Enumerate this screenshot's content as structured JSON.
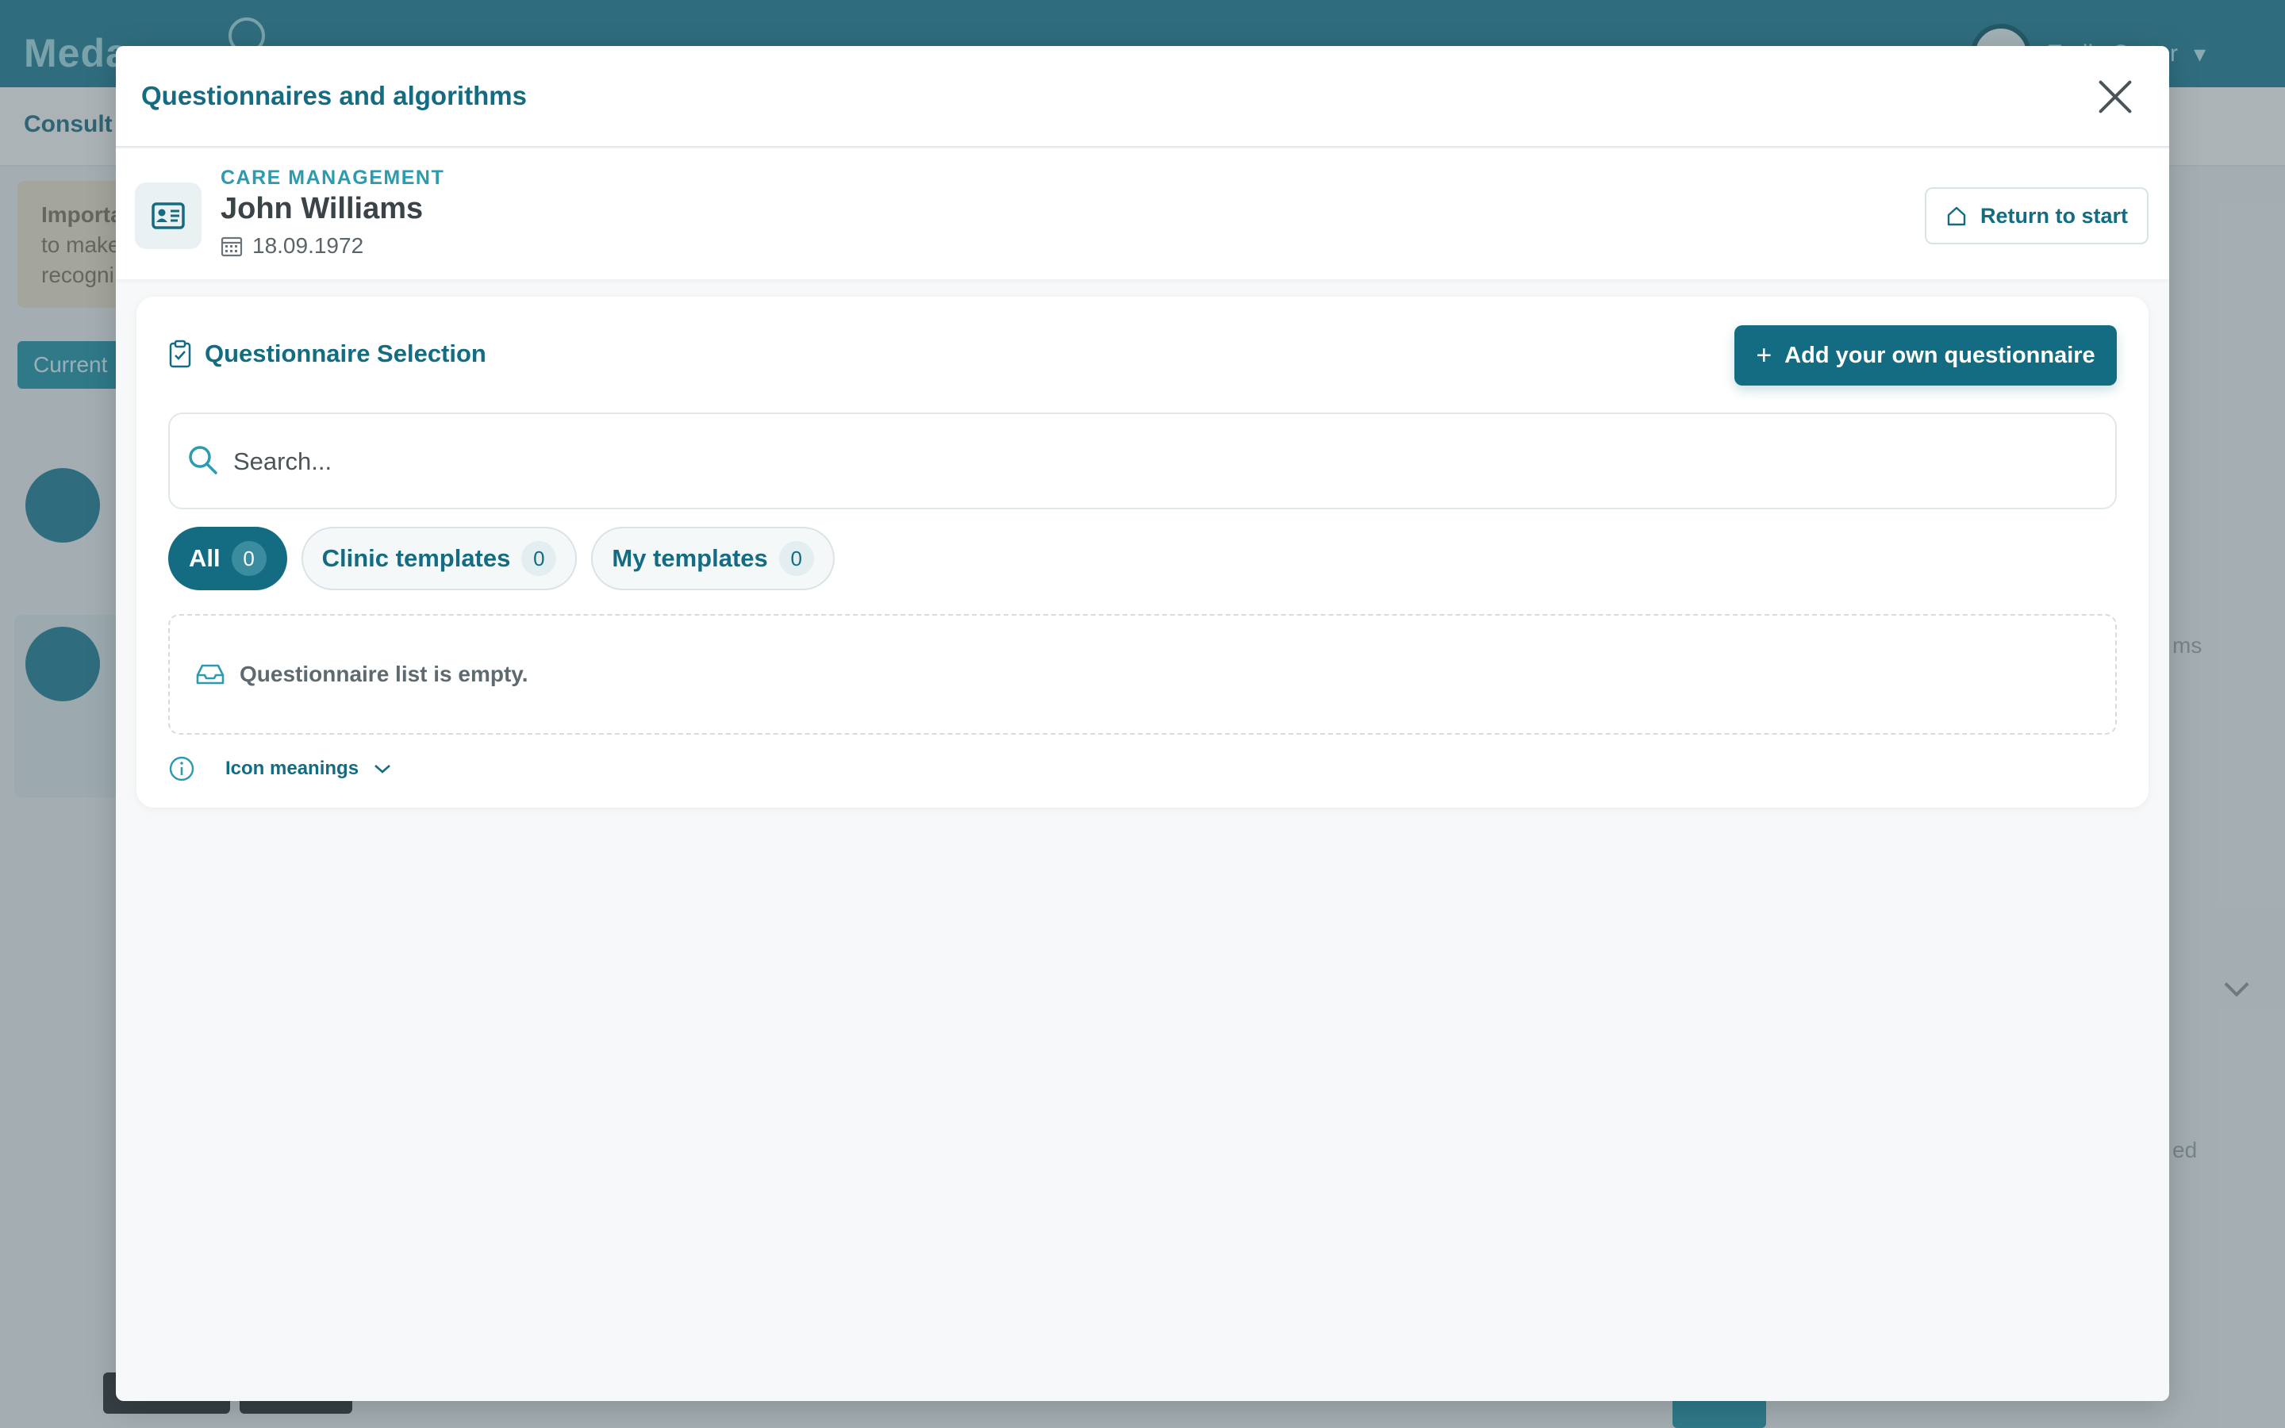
{
  "background": {
    "logo": "Meda",
    "user_name": "Emily Carter",
    "subtitle": "Consult",
    "alert_lines": [
      "Importa",
      "to make",
      "recogni"
    ],
    "current_label": "Current",
    "right_labels": [
      "ms",
      "ed"
    ]
  },
  "modal": {
    "title": "Questionnaires and algorithms",
    "close_icon": "close-icon"
  },
  "patient": {
    "category": "CARE MANAGEMENT",
    "name": "John Williams",
    "dob": "18.09.1972",
    "icon": "id-card-icon",
    "return_label": "Return to start"
  },
  "selection": {
    "title": "Questionnaire Selection",
    "add_label": "Add your own questionnaire",
    "search_placeholder": "Search...",
    "tabs": [
      {
        "label": "All",
        "count": "0"
      },
      {
        "label": "Clinic templates",
        "count": "0"
      },
      {
        "label": "My templates",
        "count": "0"
      }
    ],
    "empty_message": "Questionnaire list is empty.",
    "icon_meanings_label": "Icon meanings"
  },
  "colors": {
    "primary": "#146c82",
    "accent": "#2c9bb0",
    "topbar": "#1f7f96"
  }
}
